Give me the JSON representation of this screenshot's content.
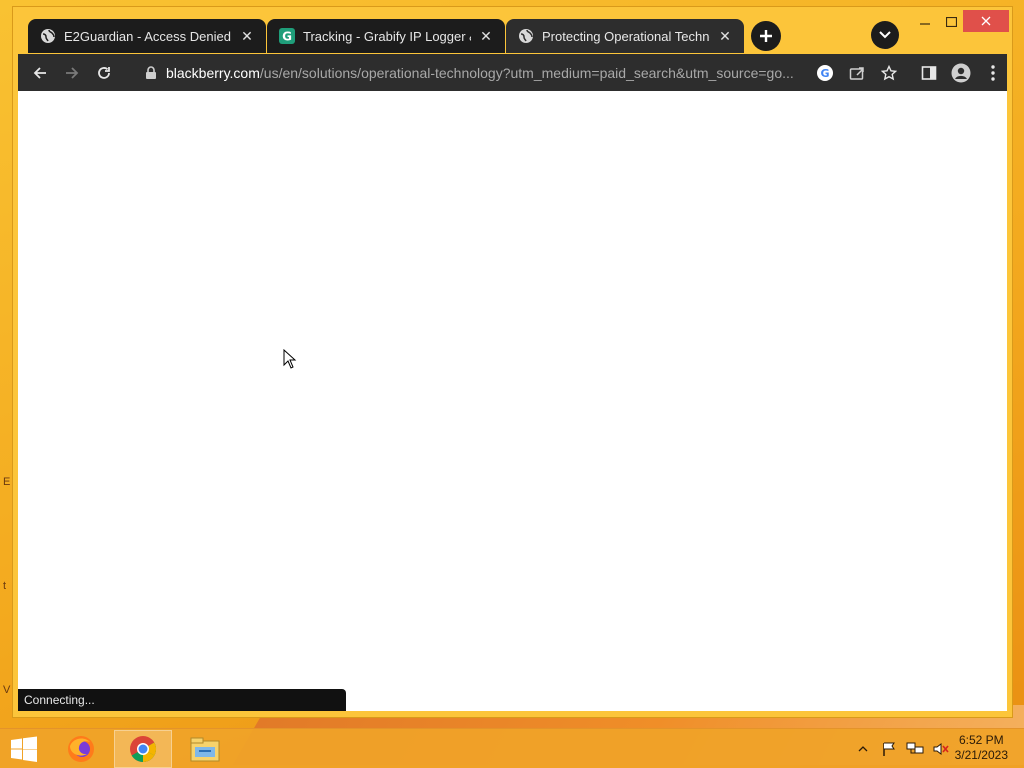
{
  "tabs": [
    {
      "title": "E2Guardian - Access Denied",
      "favicon": "globe-icon",
      "active": false
    },
    {
      "title": "Tracking - Grabify IP Logger & URL",
      "favicon": "grabify-icon",
      "active": false
    },
    {
      "title": "Protecting Operational Technology",
      "favicon": "globe-icon",
      "active": true
    }
  ],
  "omnibox": {
    "host": "blackberry.com",
    "path": "/us/en/solutions/operational-technology?utm_medium=paid_search&utm_source=go..."
  },
  "status": {
    "text": "Connecting..."
  },
  "desktop": {
    "letters": [
      "E",
      "t",
      "V"
    ]
  },
  "clock": {
    "time": "6:52 PM",
    "date": "3/21/2023"
  },
  "taskbar": {
    "items": [
      "start-icon",
      "firefox-icon",
      "chrome-icon",
      "file-explorer-icon"
    ]
  },
  "colors": {
    "wallpaper": "#f3a91e",
    "chrome_frame": "#2d2d2d",
    "close_button": "#e0504a"
  }
}
